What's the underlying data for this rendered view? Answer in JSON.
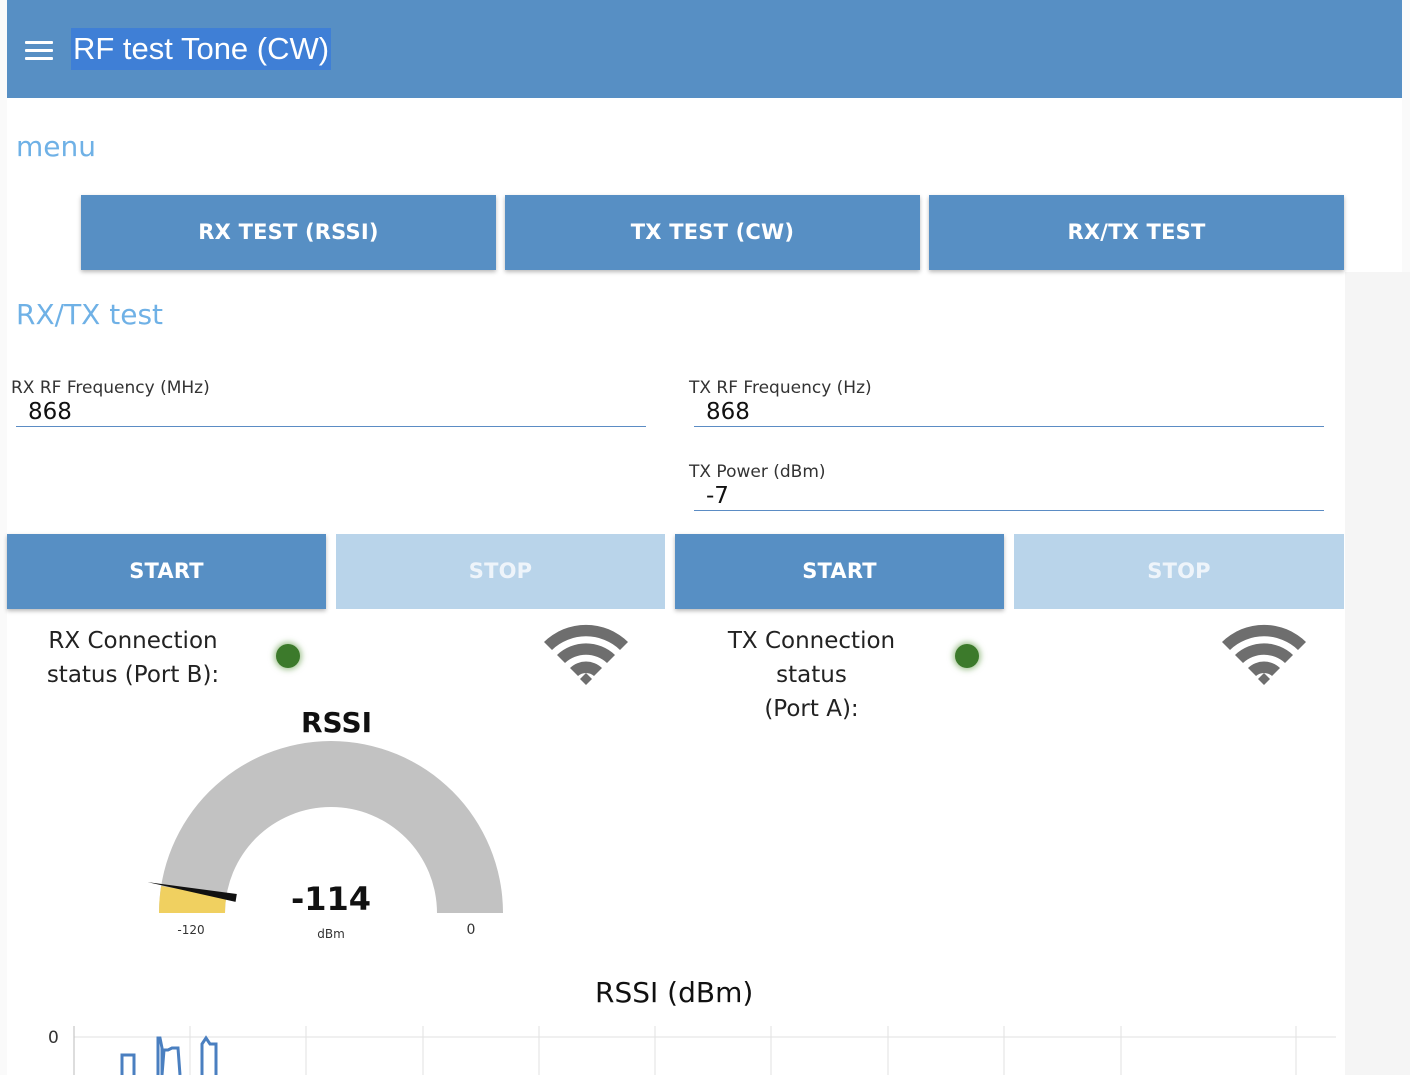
{
  "header": {
    "title": "RF test Tone (CW)"
  },
  "menu": {
    "title": "menu",
    "buttons": [
      "RX TEST (RSSI)",
      "TX TEST (CW)",
      "RX/TX TEST"
    ]
  },
  "rxtx": {
    "title": "RX/TX test",
    "rx_freq": {
      "label": "RX RF Frequency (MHz)",
      "value": "868"
    },
    "tx_freq": {
      "label": "TX RF Frequency (Hz)",
      "value": "868"
    },
    "tx_power": {
      "label": "TX Power (dBm)",
      "value": "-7"
    },
    "rx_start": "START",
    "rx_stop": "STOP",
    "tx_start": "START",
    "tx_stop": "STOP",
    "rx_status_line1": "RX Connection",
    "rx_status_line2": "status (Port B):",
    "tx_status_line1": "TX Connection status",
    "tx_status_line2": "(Port A):",
    "led_color": "#3c7a2b"
  },
  "gauge": {
    "title": "RSSI",
    "value": "-114",
    "unit": "dBm",
    "min_label": "-120",
    "max_label": "0",
    "min": -120,
    "max": 0,
    "numeric_value": -114,
    "fill_color": "#f0d060",
    "track_color": "#c2c2c2"
  },
  "chart_data": {
    "type": "line",
    "title": "RSSI (dBm)",
    "ytick_top": "0",
    "series": [
      {
        "values": []
      }
    ]
  }
}
